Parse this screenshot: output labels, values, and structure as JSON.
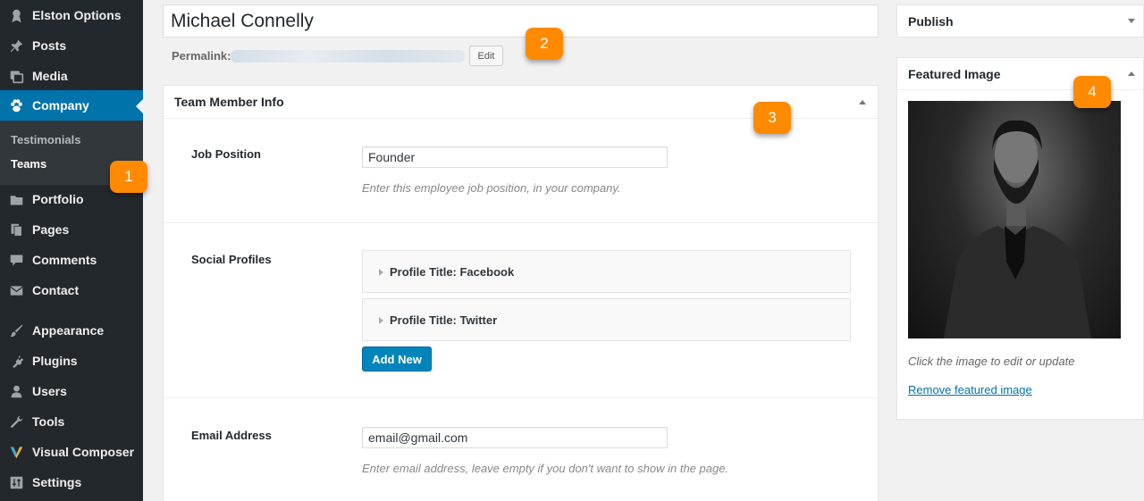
{
  "sidebar": {
    "items": [
      {
        "label": "Elston Options",
        "icon": "award-icon"
      },
      {
        "label": "Posts",
        "icon": "pin-icon"
      },
      {
        "label": "Media",
        "icon": "media-icon"
      },
      {
        "label": "Company",
        "icon": "paw-icon"
      },
      {
        "label": "Portfolio",
        "icon": "folder-icon"
      },
      {
        "label": "Pages",
        "icon": "pages-icon"
      },
      {
        "label": "Comments",
        "icon": "comment-icon"
      },
      {
        "label": "Contact",
        "icon": "mail-icon"
      },
      {
        "label": "Appearance",
        "icon": "brush-icon"
      },
      {
        "label": "Plugins",
        "icon": "plug-icon"
      },
      {
        "label": "Users",
        "icon": "user-icon"
      },
      {
        "label": "Tools",
        "icon": "wrench-icon"
      },
      {
        "label": "Visual Composer",
        "icon": "vc-icon"
      },
      {
        "label": "Settings",
        "icon": "sliders-icon"
      }
    ],
    "submenu": [
      {
        "label": "Testimonials"
      },
      {
        "label": "Teams"
      }
    ],
    "active_color": "#0073aa"
  },
  "post": {
    "title": "Michael Connelly",
    "permalink_label": "Permalink:",
    "edit_label": "Edit"
  },
  "team_box": {
    "title": "Team Member Info",
    "job_label": "Job Position",
    "job_value": "Founder",
    "job_desc": "Enter this employee job position, in your company.",
    "social_label": "Social Profiles",
    "profiles": [
      {
        "title": "Profile Title: Facebook"
      },
      {
        "title": "Profile Title: Twitter"
      }
    ],
    "add_new": "Add New",
    "email_label": "Email Address",
    "email_value": "email@gmail.com",
    "email_desc": "Enter email address, leave empty if you don't want to show in the page."
  },
  "publish_box": {
    "title": "Publish"
  },
  "featured_box": {
    "title": "Featured Image",
    "hint": "Click the image to edit or update",
    "remove": "Remove featured image"
  },
  "callouts": [
    "1",
    "2",
    "3",
    "4"
  ],
  "colors": {
    "callout": "#ff8a00",
    "button": "#0085ba",
    "sidebar": "#23282d"
  }
}
